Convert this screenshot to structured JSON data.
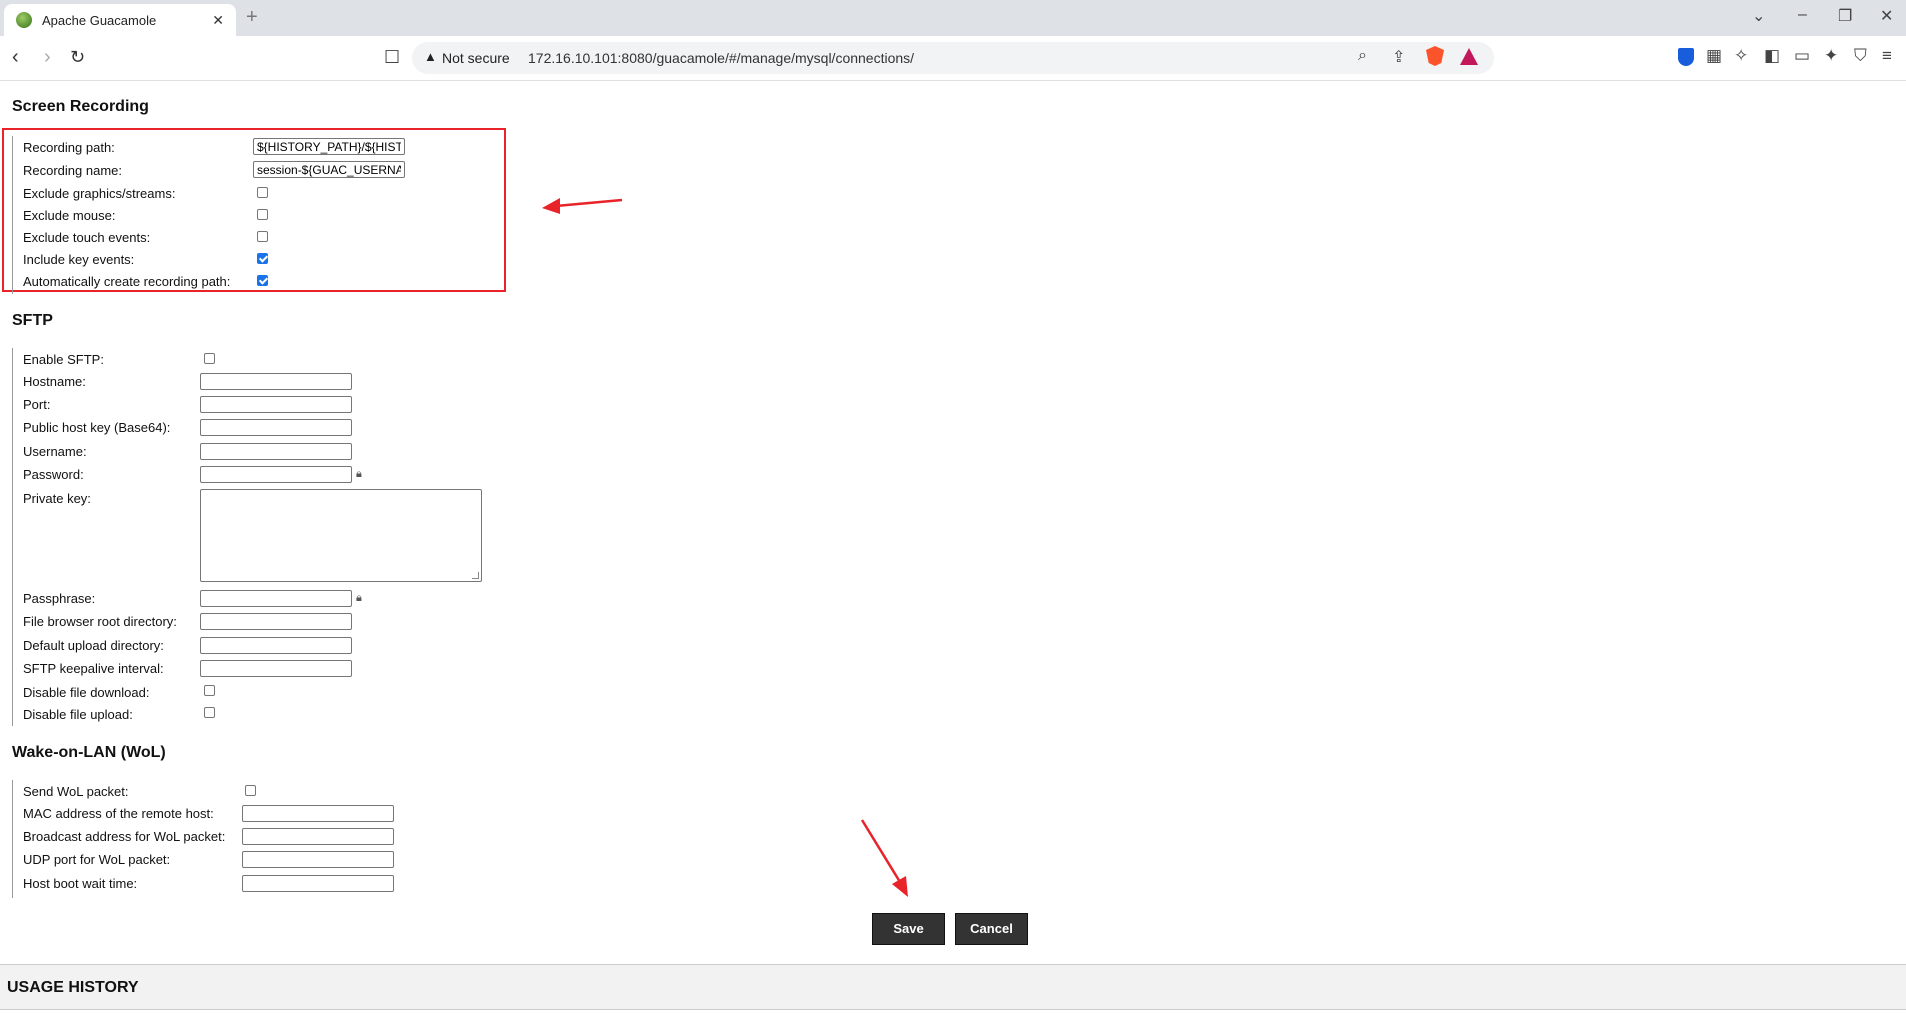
{
  "browser": {
    "tab_title": "Apache Guacamole",
    "tab_close": "✕",
    "new_tab": "+",
    "not_secure": "Not secure",
    "url": "172.16.10.101:8080/guacamole/#/manage/mysql/connections/"
  },
  "screen_recording": {
    "title": "Screen Recording",
    "recording_path_label": "Recording path:",
    "recording_path_value": "${HISTORY_PATH}/${HISTORY_UUID}",
    "recording_name_label": "Recording name:",
    "recording_name_value": "session-${GUAC_USERNAME}",
    "exclude_graphics_label": "Exclude graphics/streams:",
    "exclude_mouse_label": "Exclude mouse:",
    "exclude_touch_label": "Exclude touch events:",
    "include_key_label": "Include key events:",
    "auto_create_label": "Automatically create recording path:"
  },
  "sftp": {
    "title": "SFTP",
    "enable_label": "Enable SFTP:",
    "hostname_label": "Hostname:",
    "port_label": "Port:",
    "host_key_label": "Public host key (Base64):",
    "username_label": "Username:",
    "password_label": "Password:",
    "private_key_label": "Private key:",
    "passphrase_label": "Passphrase:",
    "root_dir_label": "File browser root directory:",
    "upload_dir_label": "Default upload directory:",
    "keepalive_label": "SFTP keepalive interval:",
    "disable_download_label": "Disable file download:",
    "disable_upload_label": "Disable file upload:"
  },
  "wol": {
    "title": "Wake-on-LAN (WoL)",
    "send_label": "Send WoL packet:",
    "mac_label": "MAC address of the remote host:",
    "broadcast_label": "Broadcast address for WoL packet:",
    "udp_label": "UDP port for WoL packet:",
    "boot_wait_label": "Host boot wait time:"
  },
  "actions": {
    "save": "Save",
    "cancel": "Cancel"
  },
  "usage_history": {
    "title": "USAGE HISTORY"
  },
  "checkbox_states": {
    "exclude_graphics": false,
    "exclude_mouse": false,
    "exclude_touch": false,
    "include_key": true,
    "auto_create": true,
    "enable_sftp": false,
    "disable_download": false,
    "disable_upload": false,
    "send_wol": false
  },
  "colors": {
    "annotation_red": "#e8232a",
    "button_bg": "#333333",
    "checkbox_checked": "#1a73e8"
  }
}
